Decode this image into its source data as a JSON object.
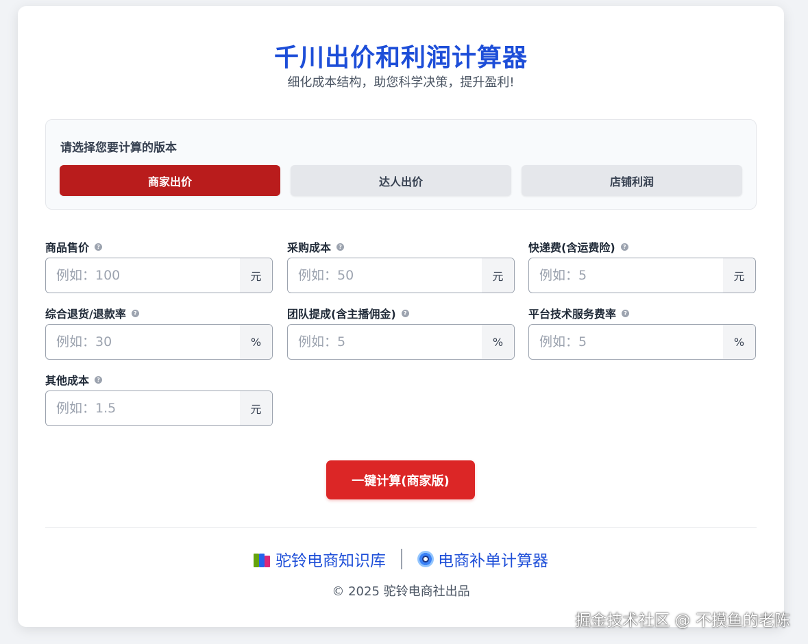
{
  "header": {
    "title": "千川出价和利润计算器",
    "subtitle": "细化成本结构，助您科学决策，提升盈利!"
  },
  "version_select": {
    "label": "请选择您要计算的版本",
    "options": [
      "商家出价",
      "达人出价",
      "店铺利润"
    ],
    "active": "商家出价"
  },
  "fields": [
    {
      "label": "商品售价",
      "placeholder": "例如：100",
      "unit": "元"
    },
    {
      "label": "采购成本",
      "placeholder": "例如：50",
      "unit": "元"
    },
    {
      "label": "快递费(含运费险)",
      "placeholder": "例如：5",
      "unit": "元"
    },
    {
      "label": "综合退货/退款率",
      "placeholder": "例如：30",
      "unit": "%"
    },
    {
      "label": "团队提成(含主播佣金)",
      "placeholder": "例如：5",
      "unit": "%"
    },
    {
      "label": "平台技术服务费率",
      "placeholder": "例如：5",
      "unit": "%"
    },
    {
      "label": "其他成本",
      "placeholder": "例如：1.5",
      "unit": "元"
    }
  ],
  "help_glyph": "?",
  "calc_button": "一键计算(商家版)",
  "footer": {
    "link1": "驼铃电商知识库",
    "link2": "电商补单计算器",
    "copyright": "© 2025 驼铃电商社出品"
  },
  "watermark": "掘金技术社区 @ 不摸鱼的老陈",
  "colors": {
    "title_blue": "#1d4ed8",
    "active_red": "#b91c1c",
    "button_red": "#dc2626"
  }
}
